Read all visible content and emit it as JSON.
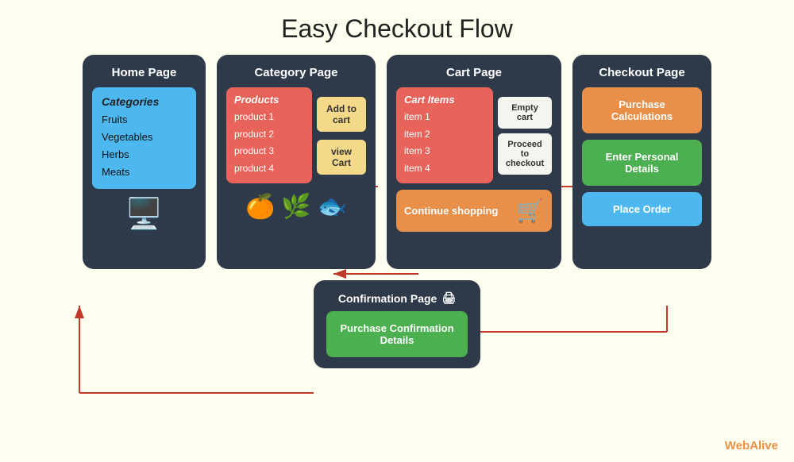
{
  "title": "Easy Checkout Flow",
  "homePage": {
    "title": "Home Page",
    "categories": {
      "label": "Categories",
      "items": [
        "Fruits",
        "Vegetables",
        "Herbs",
        "Meats"
      ]
    }
  },
  "categoryPage": {
    "title": "Category Page",
    "products": {
      "label": "Products",
      "items": [
        "product 1",
        "product 2",
        "product 3",
        "product 4"
      ]
    },
    "addToCart": "Add to cart",
    "viewCart": "view Cart"
  },
  "cartPage": {
    "title": "Cart Page",
    "cartItems": {
      "label": "Cart Items",
      "items": [
        "item 1",
        "item 2",
        "item 3",
        "item 4"
      ]
    },
    "emptyCart": "Empty cart",
    "proceedToCheckout": "Proceed to checkout",
    "continueShopping": "Continue shopping"
  },
  "checkoutPage": {
    "title": "Checkout Page",
    "purchaseCalculations": "Purchase Calculations",
    "enterPersonalDetails": "Enter Personal Details",
    "placeOrder": "Place Order"
  },
  "confirmationPage": {
    "title": "Confirmation Page",
    "icon": "🖨",
    "details": "Purchase Confirmation Details"
  },
  "brand": {
    "web": "Web",
    "alive": "Alive"
  }
}
